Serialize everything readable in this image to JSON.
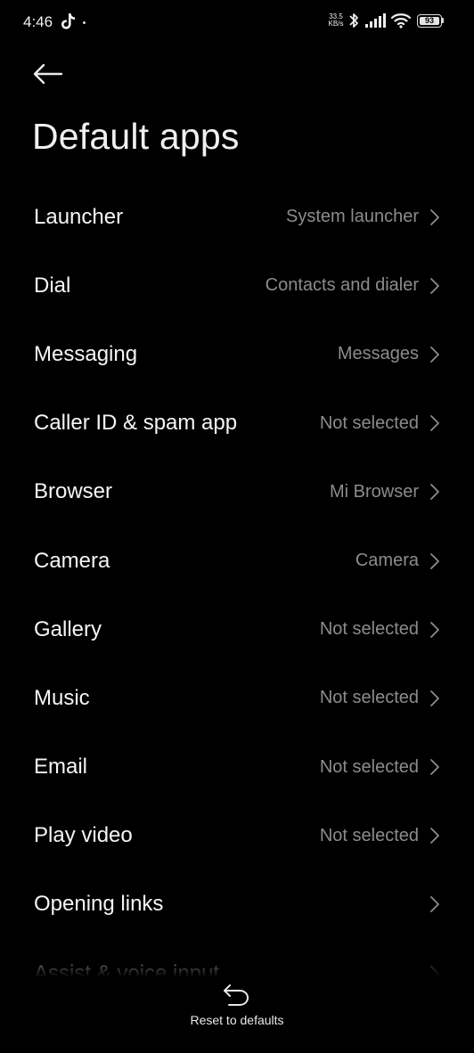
{
  "status_bar": {
    "time": "4:46",
    "net_speed_value": "33.5",
    "net_speed_unit": "KB/s",
    "battery_level": "93",
    "icons": [
      "tiktok-icon",
      "bluetooth-icon",
      "signal-icon",
      "wifi-icon",
      "battery-icon"
    ]
  },
  "header": {
    "back_icon": "arrow-left-icon",
    "title": "Default apps"
  },
  "settings": {
    "items": [
      {
        "label": "Launcher",
        "value": "System launcher"
      },
      {
        "label": "Dial",
        "value": "Contacts and dialer"
      },
      {
        "label": "Messaging",
        "value": "Messages"
      },
      {
        "label": "Caller ID & spam app",
        "value": "Not selected"
      },
      {
        "label": "Browser",
        "value": "Mi Browser"
      },
      {
        "label": "Camera",
        "value": "Camera"
      },
      {
        "label": "Gallery",
        "value": "Not selected"
      },
      {
        "label": "Music",
        "value": "Not selected"
      },
      {
        "label": "Email",
        "value": "Not selected"
      },
      {
        "label": "Play video",
        "value": "Not selected"
      },
      {
        "label": "Opening links",
        "value": ""
      },
      {
        "label": "Assist & voice input",
        "value": ""
      }
    ]
  },
  "footer": {
    "reset_icon": "undo-icon",
    "reset_label": "Reset to defaults"
  },
  "colors": {
    "background": "#000000",
    "primary_text": "#f5f5f5",
    "secondary_text": "#8c8c8c"
  }
}
